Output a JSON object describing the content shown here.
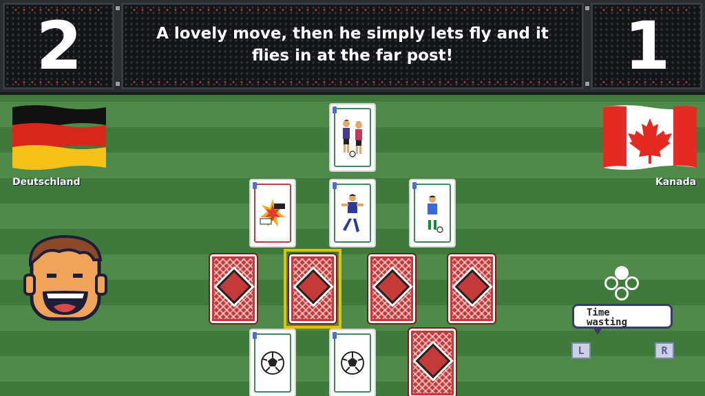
{
  "score": {
    "home": "2",
    "away": "1"
  },
  "commentary": "A lovely move, then he simply lets fly and it flies in at the far post!",
  "teams": {
    "home": "Deutschland",
    "away": "Kanada"
  },
  "action_bubble": {
    "line1": "Time",
    "line2": "wasting"
  },
  "shoulder_buttons": {
    "left": "L",
    "right": "R"
  },
  "colors": {
    "pitch_light": "#4f8a4a",
    "pitch_dark": "#3f7a3c",
    "card_back": "#c43a3a",
    "selection": "#e5c200",
    "card_frame_green": "#3e8a5a",
    "card_frame_red": "#b84040"
  },
  "cards": [
    {
      "id": "top",
      "face": "up",
      "art": "two-players-dribble-art"
    },
    {
      "id": "row2-left",
      "face": "up",
      "art": "tackle-clash-art"
    },
    {
      "id": "row2-mid",
      "face": "up",
      "art": "player-kick-art"
    },
    {
      "id": "row2-right",
      "face": "up",
      "art": "player-dribble-art"
    },
    {
      "id": "row3-1",
      "face": "down"
    },
    {
      "id": "row3-2",
      "face": "down",
      "selected": true
    },
    {
      "id": "row3-3",
      "face": "down"
    },
    {
      "id": "row3-4",
      "face": "down"
    },
    {
      "id": "row4-left",
      "face": "up",
      "art": "ball-art"
    },
    {
      "id": "row4-mid",
      "face": "up",
      "art": "ball-art"
    },
    {
      "id": "row4-right",
      "face": "down"
    }
  ]
}
